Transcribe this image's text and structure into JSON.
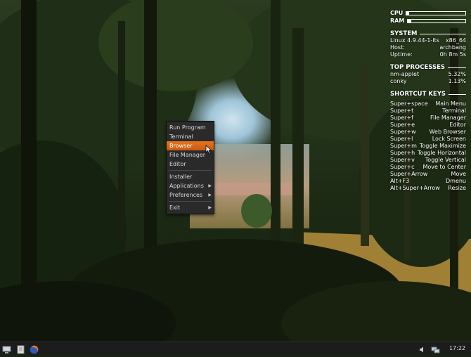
{
  "conky": {
    "cpu_label": "CPU",
    "cpu_level": 0.04,
    "ram_label": "RAM",
    "ram_level": 0.06,
    "system": {
      "title": "SYSTEM",
      "kernel": "Linux 4.9.44-1-lts",
      "arch": "x86_64",
      "host_label": "Host:",
      "host": "archbang",
      "uptime_label": "Uptime:",
      "uptime": "0h 8m 5s"
    },
    "top_processes": {
      "title": "TOP PROCESSES",
      "rows": [
        {
          "name": "nm-applet",
          "value": "5.32%"
        },
        {
          "name": "conky",
          "value": "1.13%"
        }
      ]
    },
    "shortcuts": {
      "title": "SHORTCUT KEYS",
      "rows": [
        {
          "key": "Super+space",
          "action": "Main Menu"
        },
        {
          "key": "Super+t",
          "action": "Terminal"
        },
        {
          "key": "Super+f",
          "action": "File Manager"
        },
        {
          "key": "Super+e",
          "action": "Editor"
        },
        {
          "key": "Super+w",
          "action": "Web Browser"
        },
        {
          "key": "Super+l",
          "action": "Lock Screen"
        },
        {
          "key": "Super+m",
          "action": "Toggle Maximize"
        },
        {
          "key": "Super+h",
          "action": "Toggle Horizontal"
        },
        {
          "key": "Super+v",
          "action": "Toggle Vertical"
        },
        {
          "key": "Super+c",
          "action": "Move to Center"
        },
        {
          "key": "Super+Arrow",
          "action": "Move"
        },
        {
          "key": "Alt+F3",
          "action": "Dmenu"
        },
        {
          "key": "Alt+Super+Arrow",
          "action": "Resize"
        }
      ]
    }
  },
  "menu": {
    "items": [
      {
        "label": "Run Program"
      },
      {
        "label": "Terminal"
      },
      {
        "label": "Browser"
      },
      {
        "label": "File Manager"
      },
      {
        "label": "Editor"
      },
      {
        "label": "Installer"
      },
      {
        "label": "Applications"
      },
      {
        "label": "Preferences"
      },
      {
        "label": "Exit"
      }
    ]
  },
  "taskbar": {
    "clock": "17:22",
    "icons": [
      "show-desktop-icon",
      "file-manager-icon",
      "firefox-icon",
      "volume-icon",
      "network-icon"
    ]
  },
  "colors": {
    "menu_highlight": "#e8731f",
    "menu_bg": "#2a2a2a",
    "taskbar_bg": "#1c1c1c"
  }
}
